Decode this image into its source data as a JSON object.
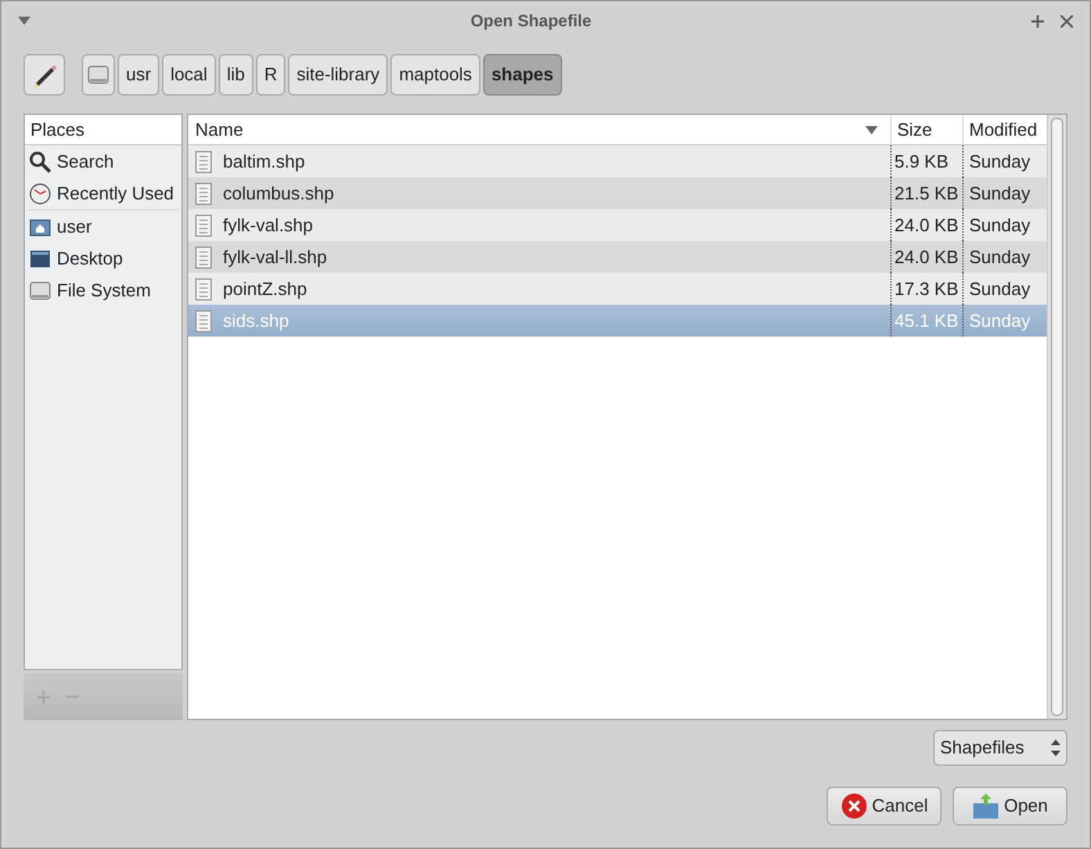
{
  "window": {
    "title": "Open Shapefile"
  },
  "path_bar": [
    {
      "label": "usr",
      "selected": false
    },
    {
      "label": "local",
      "selected": false
    },
    {
      "label": "lib",
      "selected": false
    },
    {
      "label": "R",
      "selected": false
    },
    {
      "label": "site-library",
      "selected": false
    },
    {
      "label": "maptools",
      "selected": false
    },
    {
      "label": "shapes",
      "selected": true
    }
  ],
  "places": {
    "heading": "Places",
    "sections": [
      [
        {
          "label": "Search",
          "kind": "search"
        },
        {
          "label": "Recently Used",
          "kind": "recent"
        }
      ],
      [
        {
          "label": "user",
          "kind": "home"
        },
        {
          "label": "Desktop",
          "kind": "desktop"
        },
        {
          "label": "File System",
          "kind": "drive"
        }
      ]
    ],
    "add_remove_disabled": true
  },
  "files": {
    "columns": [
      "Name",
      "Size",
      "Modified"
    ],
    "rows": [
      {
        "name": "baltim.shp",
        "size": "5.9 KB",
        "modified": "Sunday",
        "selected": false
      },
      {
        "name": "columbus.shp",
        "size": "21.5 KB",
        "modified": "Sunday",
        "selected": false
      },
      {
        "name": "fylk-val.shp",
        "size": "24.0 KB",
        "modified": "Sunday",
        "selected": false
      },
      {
        "name": "fylk-val-ll.shp",
        "size": "24.0 KB",
        "modified": "Sunday",
        "selected": false
      },
      {
        "name": "pointZ.shp",
        "size": "17.3 KB",
        "modified": "Sunday",
        "selected": false
      },
      {
        "name": "sids.shp",
        "size": "45.1 KB",
        "modified": "Sunday",
        "selected": true
      }
    ]
  },
  "filter": {
    "value": "Shapefiles"
  },
  "buttons": [
    {
      "label": "Cancel",
      "kind": "cancel"
    },
    {
      "label": "Open",
      "kind": "open"
    }
  ]
}
